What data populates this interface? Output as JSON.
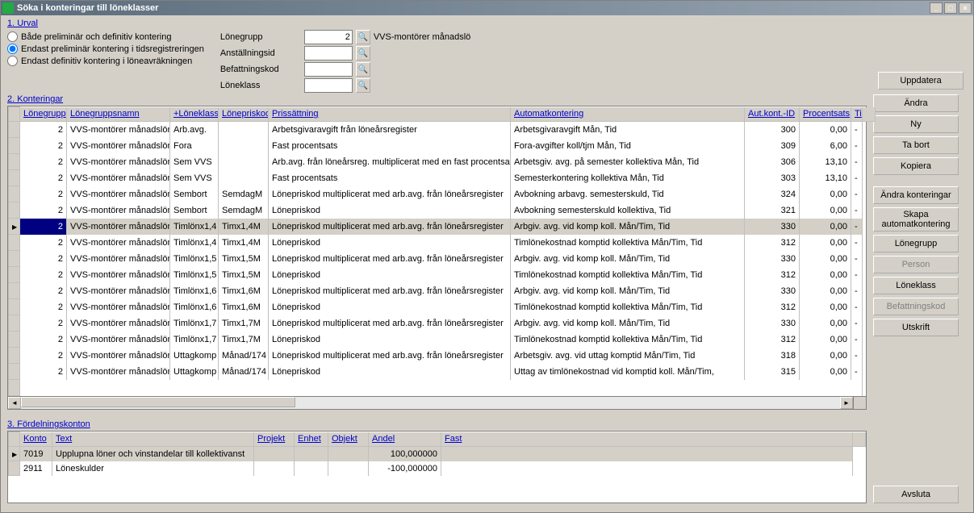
{
  "window": {
    "title": "Söka i konteringar till löneklasser"
  },
  "sections": {
    "urval": "1. Urval",
    "konteringar": "2. Konteringar",
    "fordelning": "3. Fördelningskonton"
  },
  "radios": {
    "r1": "Både preliminär och definitiv kontering",
    "r2": "Endast preliminär kontering i tidsregistreringen",
    "r3": "Endast definitiv kontering i löneavräkningen"
  },
  "fields": {
    "lonegrupp_label": "Lönegrupp",
    "lonegrupp_value": "2",
    "lonegrupp_desc": "VVS-montörer månadslö",
    "anstallningsid_label": "Anställningsid",
    "befattningskod_label": "Befattningskod",
    "loneklass_label": "Löneklass"
  },
  "buttons": {
    "uppdatera": "Uppdatera",
    "andra": "Ändra",
    "ny": "Ny",
    "tabort": "Ta bort",
    "kopiera": "Kopiera",
    "andra_kont": "Ändra konteringar",
    "skapa": "Skapa automatkontering",
    "lonegrupp": "Lönegrupp",
    "person": "Person",
    "loneklass": "Löneklass",
    "befattningskod": "Befattningskod",
    "utskrift": "Utskrift",
    "avsluta": "Avsluta"
  },
  "grid1": {
    "headers": [
      "Lönegrupp",
      "Lönegruppsnamn",
      "+Löneklass",
      "Lönepriskod",
      "Prissättning",
      "Automatkontering",
      "Aut.kont.-ID",
      "Procentsats",
      "Ti"
    ],
    "rows": [
      {
        "lg": "2",
        "namn": "VVS-montörer månadslön",
        "lk": "Arb.avg.",
        "lpk": "",
        "pris": "Arbetsgivaravgift från löneårsregister",
        "auto": "Arbetsgivaravgift Mån, Tid",
        "id": "300",
        "pct": "0,00",
        "ti": "-"
      },
      {
        "lg": "2",
        "namn": "VVS-montörer månadslön",
        "lk": "Fora",
        "lpk": "",
        "pris": "Fast procentsats",
        "auto": "Fora-avgifter koll/tjm Mån, Tid",
        "id": "309",
        "pct": "6,00",
        "ti": "-"
      },
      {
        "lg": "2",
        "namn": "VVS-montörer månadslön",
        "lk": "Sem VVS",
        "lpk": "",
        "pris": "Arb.avg. från löneårsreg. multiplicerat med en fast procentsats",
        "auto": "Arbetsgiv. avg. på semester kollektiva Mån, Tid",
        "id": "306",
        "pct": "13,10",
        "ti": "-"
      },
      {
        "lg": "2",
        "namn": "VVS-montörer månadslön",
        "lk": "Sem VVS",
        "lpk": "",
        "pris": "Fast procentsats",
        "auto": "Semesterkontering kollektiva Mån, Tid",
        "id": "303",
        "pct": "13,10",
        "ti": "-"
      },
      {
        "lg": "2",
        "namn": "VVS-montörer månadslön",
        "lk": "Sembort",
        "lpk": "SemdagM",
        "pris": "Lönepriskod multiplicerat med arb.avg. från löneårsregister",
        "auto": "Avbokning arbavg. semesterskuld, Tid",
        "id": "324",
        "pct": "0,00",
        "ti": "-"
      },
      {
        "lg": "2",
        "namn": "VVS-montörer månadslön",
        "lk": "Sembort",
        "lpk": "SemdagM",
        "pris": "Lönepriskod",
        "auto": "Avbokning semesterskuld kollektiva, Tid",
        "id": "321",
        "pct": "0,00",
        "ti": "-"
      },
      {
        "lg": "2",
        "namn": "VVS-montörer månadslön",
        "lk": "Timlönx1,4",
        "lpk": "Timx1,4M",
        "pris": "Lönepriskod multiplicerat med arb.avg. från löneårsregister",
        "auto": "Arbgiv. avg. vid komp koll. Mån/Tim, Tid",
        "id": "330",
        "pct": "0,00",
        "ti": "-",
        "sel": true
      },
      {
        "lg": "2",
        "namn": "VVS-montörer månadslön",
        "lk": "Timlönx1,4",
        "lpk": "Timx1,4M",
        "pris": "Lönepriskod",
        "auto": "Timlönekostnad komptid kollektiva Mån/Tim, Tid",
        "id": "312",
        "pct": "0,00",
        "ti": "-"
      },
      {
        "lg": "2",
        "namn": "VVS-montörer månadslön",
        "lk": "Timlönx1,5",
        "lpk": "Timx1,5M",
        "pris": "Lönepriskod multiplicerat med arb.avg. från löneårsregister",
        "auto": "Arbgiv. avg. vid komp koll. Mån/Tim, Tid",
        "id": "330",
        "pct": "0,00",
        "ti": "-"
      },
      {
        "lg": "2",
        "namn": "VVS-montörer månadslön",
        "lk": "Timlönx1,5",
        "lpk": "Timx1,5M",
        "pris": "Lönepriskod",
        "auto": "Timlönekostnad komptid kollektiva Mån/Tim, Tid",
        "id": "312",
        "pct": "0,00",
        "ti": "-"
      },
      {
        "lg": "2",
        "namn": "VVS-montörer månadslön",
        "lk": "Timlönx1,6",
        "lpk": "Timx1,6M",
        "pris": "Lönepriskod multiplicerat med arb.avg. från löneårsregister",
        "auto": "Arbgiv. avg. vid komp koll. Mån/Tim, Tid",
        "id": "330",
        "pct": "0,00",
        "ti": "-"
      },
      {
        "lg": "2",
        "namn": "VVS-montörer månadslön",
        "lk": "Timlönx1,6",
        "lpk": "Timx1,6M",
        "pris": "Lönepriskod",
        "auto": "Timlönekostnad komptid kollektiva Mån/Tim, Tid",
        "id": "312",
        "pct": "0,00",
        "ti": "-"
      },
      {
        "lg": "2",
        "namn": "VVS-montörer månadslön",
        "lk": "Timlönx1,7",
        "lpk": "Timx1,7M",
        "pris": "Lönepriskod multiplicerat med arb.avg. från löneårsregister",
        "auto": "Arbgiv. avg. vid komp koll. Mån/Tim, Tid",
        "id": "330",
        "pct": "0,00",
        "ti": "-"
      },
      {
        "lg": "2",
        "namn": "VVS-montörer månadslön",
        "lk": "Timlönx1,7",
        "lpk": "Timx1,7M",
        "pris": "Lönepriskod",
        "auto": "Timlönekostnad komptid kollektiva Mån/Tim, Tid",
        "id": "312",
        "pct": "0,00",
        "ti": "-"
      },
      {
        "lg": "2",
        "namn": "VVS-montörer månadslön",
        "lk": "Uttagkomp",
        "lpk": "Månad/174",
        "pris": "Lönepriskod multiplicerat med arb.avg. från löneårsregister",
        "auto": "Arbetsgiv. avg. vid uttag komptid Mån/Tim, Tid",
        "id": "318",
        "pct": "0,00",
        "ti": "-"
      },
      {
        "lg": "2",
        "namn": "VVS-montörer månadslön",
        "lk": "Uttagkomp",
        "lpk": "Månad/174",
        "pris": "Lönepriskod",
        "auto": "Uttag av timlönekostnad vid komptid koll. Mån/Tim,",
        "id": "315",
        "pct": "0,00",
        "ti": "-"
      }
    ]
  },
  "grid2": {
    "headers": [
      "Konto",
      "Text",
      "Projekt",
      "Enhet",
      "Objekt",
      "Andel",
      "Fast"
    ],
    "rows": [
      {
        "konto": "7019",
        "text": "Upplupna löner och vinstandelar till kollektivanst",
        "proj": "",
        "enh": "",
        "obj": "",
        "andel": "100,000000",
        "fast": "",
        "sel": true
      },
      {
        "konto": "2911",
        "text": "Löneskulder",
        "proj": "",
        "enh": "",
        "obj": "",
        "andel": "-100,000000",
        "fast": ""
      }
    ]
  }
}
